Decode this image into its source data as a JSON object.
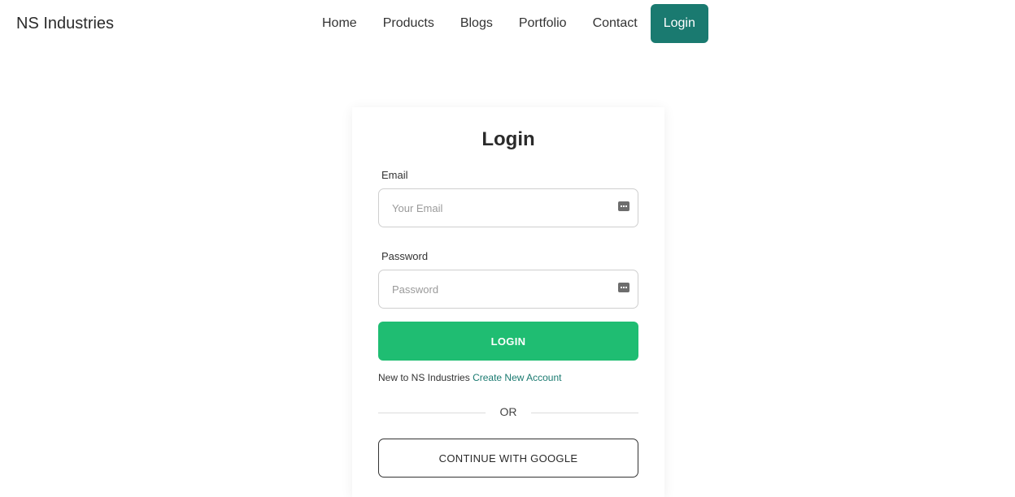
{
  "brand": "NS Industries",
  "nav": {
    "items": [
      {
        "label": "Home"
      },
      {
        "label": "Products"
      },
      {
        "label": "Blogs"
      },
      {
        "label": "Portfolio"
      },
      {
        "label": "Contact"
      }
    ],
    "login_label": "Login"
  },
  "form": {
    "title": "Login",
    "email_label": "Email",
    "email_placeholder": "Your Email",
    "email_value": "",
    "password_label": "Password",
    "password_placeholder": "Password",
    "password_value": "",
    "field_icon": "keyboard-icon",
    "login_button": "LOGIN",
    "signup_prompt": "New to NS Industries",
    "signup_link": "Create New Account",
    "divider_text": "OR",
    "google_button": "CONTINUE WITH GOOGLE"
  },
  "colors": {
    "nav_login_bg": "#1a7a70",
    "login_button_bg": "#1fbd72",
    "link": "#1a7a70"
  }
}
